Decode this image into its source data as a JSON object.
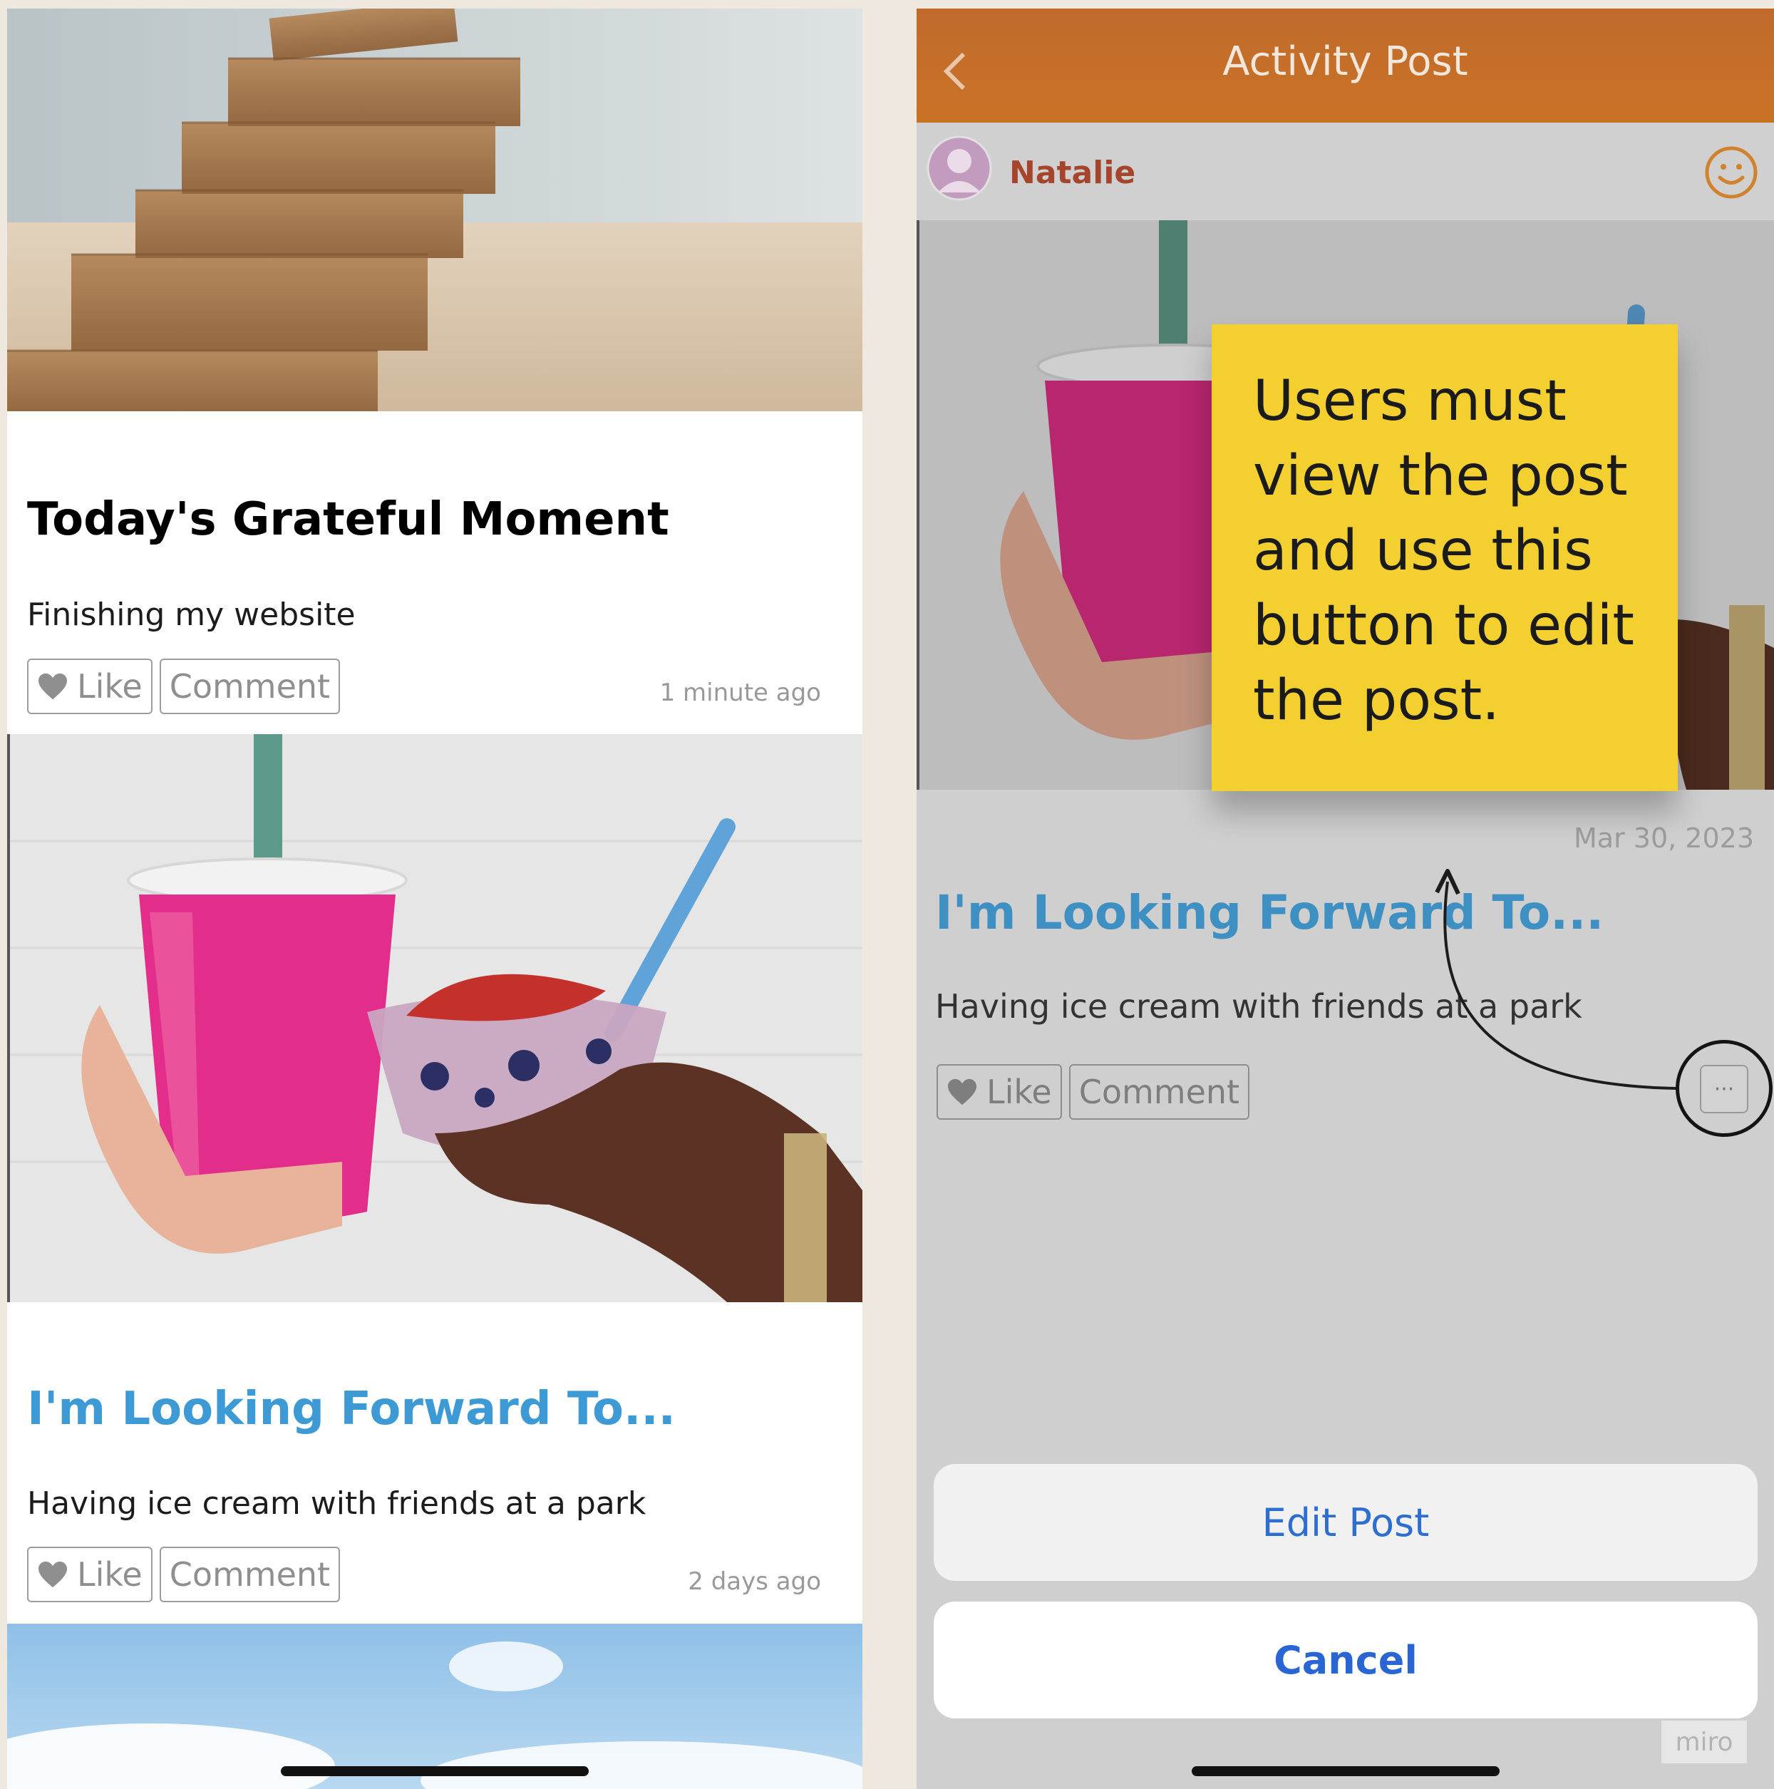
{
  "feed": {
    "posts": [
      {
        "title": "Today's Grateful Moment",
        "body": "Finishing my website",
        "like_label": "Like",
        "comment_label": "Comment",
        "time": "1 minute ago",
        "title_color": "#e8843f",
        "image_icon": "wooden-blocks-image"
      },
      {
        "title": "I'm Looking Forward To...",
        "body": "Having ice cream with friends at a park",
        "like_label": "Like",
        "comment_label": "Comment",
        "time": "2 days ago",
        "title_color": "#3d9ad4",
        "image_icon": "smoothie-bowl-image"
      }
    ]
  },
  "detail": {
    "nav_title": "Activity Post",
    "author": "Natalie",
    "date": "Mar 30, 2023",
    "title": "I'm Looking Forward To...",
    "body": "Having ice cream with friends at a park",
    "like_label": "Like",
    "comment_label": "Comment",
    "more_label": "···",
    "annotation": "Users must view the post and use this button to edit the post.",
    "sheet": {
      "edit_label": "Edit Post",
      "cancel_label": "Cancel"
    },
    "watermark": "miro",
    "nav_color": "#c46f29",
    "sticky_color": "#f3d02f"
  }
}
